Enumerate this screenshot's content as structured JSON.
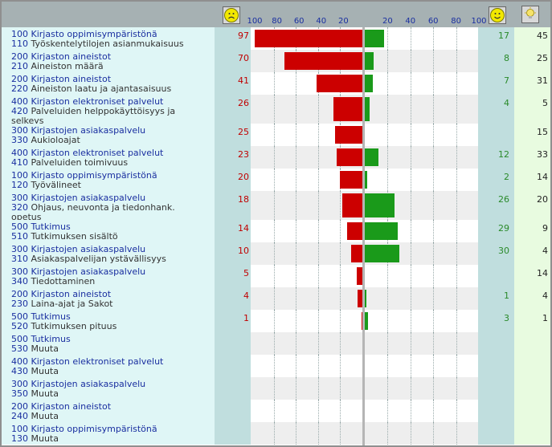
{
  "chart_data": {
    "type": "bar",
    "axis_ticks_left": [
      "100",
      "80",
      "60",
      "40",
      "20"
    ],
    "axis_ticks_right": [
      "20",
      "40",
      "60",
      "80",
      "100"
    ],
    "negative_range": [
      0,
      100
    ],
    "positive_range": [
      0,
      100
    ],
    "icons": {
      "negative": "sad-face-icon",
      "positive": "happy-face-icon",
      "neutral": "idea-bulb-icon"
    },
    "colors": {
      "negative": "#cc0000",
      "positive": "#1a9a1a",
      "category_text": "#1a2fa0"
    },
    "rows": [
      {
        "c1": "100",
        "n1": "Kirjasto oppimisympäristönä",
        "c2": "110",
        "n2": "Työskentelytilojen asianmukaisuus",
        "neg": 97,
        "pos": 17,
        "neu": 45
      },
      {
        "c1": "200",
        "n1": "Kirjaston aineistot",
        "c2": "210",
        "n2": "Aineiston määrä",
        "neg": 70,
        "pos": 8,
        "neu": 25
      },
      {
        "c1": "200",
        "n1": "Kirjaston aineistot",
        "c2": "220",
        "n2": "Aineiston laatu ja ajantasaisuus",
        "neg": 41,
        "pos": 7,
        "neu": 31
      },
      {
        "c1": "400",
        "n1": "Kirjaston elektroniset palvelut",
        "c2": "420",
        "n2": "Palveluiden helppokäyttöisyys ja",
        "n3": "selkeys",
        "neg": 26,
        "pos": 4,
        "neu": 5
      },
      {
        "c1": "300",
        "n1": "Kirjastojen asiakaspalvelu",
        "c2": "330",
        "n2": "Aukioloajat",
        "neg": 25,
        "pos": null,
        "neu": 15
      },
      {
        "c1": "400",
        "n1": "Kirjaston elektroniset palvelut",
        "c2": "410",
        "n2": "Palveluiden toimivuus",
        "neg": 23,
        "pos": 12,
        "neu": 33
      },
      {
        "c1": "100",
        "n1": "Kirjasto oppimisympäristönä",
        "c2": "120",
        "n2": "Työvälineet",
        "neg": 20,
        "pos": 2,
        "neu": 14
      },
      {
        "c1": "300",
        "n1": "Kirjastojen asiakaspalvelu",
        "c2": "320",
        "n2": "Ohjaus, neuvonta ja tiedonhank.",
        "n3": "opetus",
        "neg": 18,
        "pos": 26,
        "neu": 20
      },
      {
        "c1": "500",
        "n1": "Tutkimus",
        "c2": "510",
        "n2": "Tutkimuksen sisältö",
        "neg": 14,
        "pos": 29,
        "neu": 9
      },
      {
        "c1": "300",
        "n1": "Kirjastojen asiakaspalvelu",
        "c2": "310",
        "n2": "Asiakaspalvelijan ystävällisyys",
        "neg": 10,
        "pos": 30,
        "neu": 4
      },
      {
        "c1": "300",
        "n1": "Kirjastojen asiakaspalvelu",
        "c2": "340",
        "n2": "Tiedottaminen",
        "neg": 5,
        "pos": null,
        "neu": 14
      },
      {
        "c1": "200",
        "n1": "Kirjaston aineistot",
        "c2": "230",
        "n2": "Laina-ajat ja Sakot",
        "neg": 4,
        "pos": 1,
        "neu": 4
      },
      {
        "c1": "500",
        "n1": "Tutkimus",
        "c2": "520",
        "n2": "Tutkimuksen pituus",
        "neg": 1,
        "pos": 3,
        "neu": 1
      },
      {
        "c1": "500",
        "n1": "Tutkimus",
        "c2": "530",
        "n2": "Muuta",
        "neg": null,
        "pos": null,
        "neu": null
      },
      {
        "c1": "400",
        "n1": "Kirjaston elektroniset palvelut",
        "c2": "430",
        "n2": "Muuta",
        "neg": null,
        "pos": null,
        "neu": null
      },
      {
        "c1": "300",
        "n1": "Kirjastojen asiakaspalvelu",
        "c2": "350",
        "n2": "Muuta",
        "neg": null,
        "pos": null,
        "neu": null
      },
      {
        "c1": "200",
        "n1": "Kirjaston aineistot",
        "c2": "240",
        "n2": "Muuta",
        "neg": null,
        "pos": null,
        "neu": null
      },
      {
        "c1": "100",
        "n1": "Kirjasto oppimisympäristönä",
        "c2": "130",
        "n2": "Muuta",
        "neg": null,
        "pos": null,
        "neu": null
      }
    ]
  }
}
